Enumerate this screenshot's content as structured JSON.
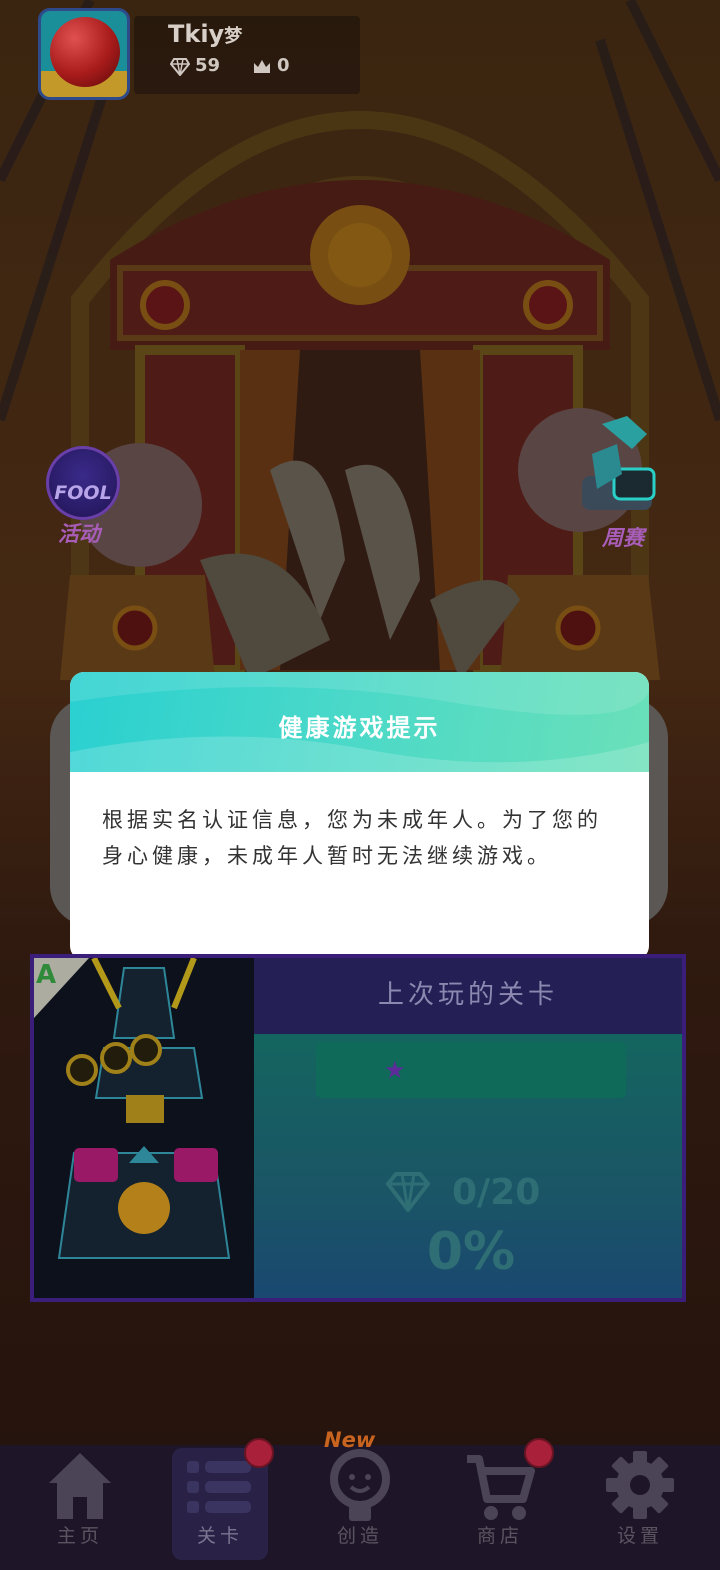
{
  "profile": {
    "player_name": "Tkiy",
    "name_suffix": "梦",
    "gems": "59",
    "crowns": "0"
  },
  "side_buttons": {
    "event_badge_text": "FOOL",
    "event_label": "活动",
    "weekly_label": "周赛"
  },
  "dialog": {
    "title": "健康游戏提示",
    "message": "根据实名认证信息，您为未成年人。为了您的身心健康，未成年人暂时无法继续游戏。"
  },
  "last_level": {
    "grade": "A",
    "title": "上次玩的关卡",
    "stars_earned": 0,
    "diamonds": "0/20",
    "progress_percent": "0%"
  },
  "bottom_nav": {
    "items": [
      {
        "label": "主页",
        "icon": "home-icon",
        "active": false,
        "notification": false
      },
      {
        "label": "关卡",
        "icon": "list-icon",
        "active": true,
        "notification": true
      },
      {
        "label": "创造",
        "icon": "lightbulb-icon",
        "active": false,
        "notification": false,
        "tag": "New"
      },
      {
        "label": "商店",
        "icon": "cart-icon",
        "active": false,
        "notification": true
      },
      {
        "label": "设置",
        "icon": "gear-icon",
        "active": false,
        "notification": false
      }
    ]
  },
  "colors": {
    "dialog_header_start": "#2ad0d0",
    "dialog_header_end": "#6ae0b8",
    "notification": "#a8203a",
    "card_border": "#3b1e7a"
  }
}
